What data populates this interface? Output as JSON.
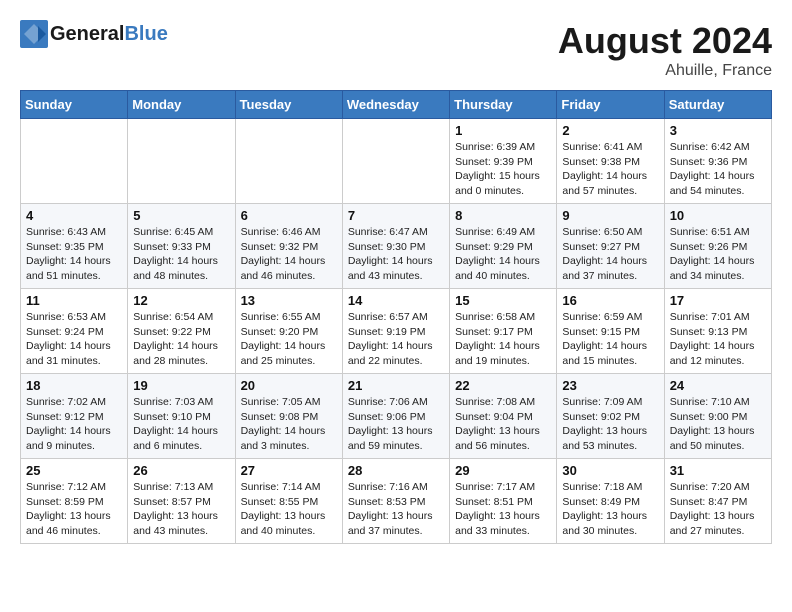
{
  "header": {
    "logo_text_general": "General",
    "logo_text_blue": "Blue",
    "month_year": "August 2024",
    "location": "Ahuille, France"
  },
  "calendar": {
    "days_of_week": [
      "Sunday",
      "Monday",
      "Tuesday",
      "Wednesday",
      "Thursday",
      "Friday",
      "Saturday"
    ],
    "weeks": [
      [
        {
          "day": "",
          "info": ""
        },
        {
          "day": "",
          "info": ""
        },
        {
          "day": "",
          "info": ""
        },
        {
          "day": "",
          "info": ""
        },
        {
          "day": "1",
          "info": "Sunrise: 6:39 AM\nSunset: 9:39 PM\nDaylight: 15 hours\nand 0 minutes."
        },
        {
          "day": "2",
          "info": "Sunrise: 6:41 AM\nSunset: 9:38 PM\nDaylight: 14 hours\nand 57 minutes."
        },
        {
          "day": "3",
          "info": "Sunrise: 6:42 AM\nSunset: 9:36 PM\nDaylight: 14 hours\nand 54 minutes."
        }
      ],
      [
        {
          "day": "4",
          "info": "Sunrise: 6:43 AM\nSunset: 9:35 PM\nDaylight: 14 hours\nand 51 minutes."
        },
        {
          "day": "5",
          "info": "Sunrise: 6:45 AM\nSunset: 9:33 PM\nDaylight: 14 hours\nand 48 minutes."
        },
        {
          "day": "6",
          "info": "Sunrise: 6:46 AM\nSunset: 9:32 PM\nDaylight: 14 hours\nand 46 minutes."
        },
        {
          "day": "7",
          "info": "Sunrise: 6:47 AM\nSunset: 9:30 PM\nDaylight: 14 hours\nand 43 minutes."
        },
        {
          "day": "8",
          "info": "Sunrise: 6:49 AM\nSunset: 9:29 PM\nDaylight: 14 hours\nand 40 minutes."
        },
        {
          "day": "9",
          "info": "Sunrise: 6:50 AM\nSunset: 9:27 PM\nDaylight: 14 hours\nand 37 minutes."
        },
        {
          "day": "10",
          "info": "Sunrise: 6:51 AM\nSunset: 9:26 PM\nDaylight: 14 hours\nand 34 minutes."
        }
      ],
      [
        {
          "day": "11",
          "info": "Sunrise: 6:53 AM\nSunset: 9:24 PM\nDaylight: 14 hours\nand 31 minutes."
        },
        {
          "day": "12",
          "info": "Sunrise: 6:54 AM\nSunset: 9:22 PM\nDaylight: 14 hours\nand 28 minutes."
        },
        {
          "day": "13",
          "info": "Sunrise: 6:55 AM\nSunset: 9:20 PM\nDaylight: 14 hours\nand 25 minutes."
        },
        {
          "day": "14",
          "info": "Sunrise: 6:57 AM\nSunset: 9:19 PM\nDaylight: 14 hours\nand 22 minutes."
        },
        {
          "day": "15",
          "info": "Sunrise: 6:58 AM\nSunset: 9:17 PM\nDaylight: 14 hours\nand 19 minutes."
        },
        {
          "day": "16",
          "info": "Sunrise: 6:59 AM\nSunset: 9:15 PM\nDaylight: 14 hours\nand 15 minutes."
        },
        {
          "day": "17",
          "info": "Sunrise: 7:01 AM\nSunset: 9:13 PM\nDaylight: 14 hours\nand 12 minutes."
        }
      ],
      [
        {
          "day": "18",
          "info": "Sunrise: 7:02 AM\nSunset: 9:12 PM\nDaylight: 14 hours\nand 9 minutes."
        },
        {
          "day": "19",
          "info": "Sunrise: 7:03 AM\nSunset: 9:10 PM\nDaylight: 14 hours\nand 6 minutes."
        },
        {
          "day": "20",
          "info": "Sunrise: 7:05 AM\nSunset: 9:08 PM\nDaylight: 14 hours\nand 3 minutes."
        },
        {
          "day": "21",
          "info": "Sunrise: 7:06 AM\nSunset: 9:06 PM\nDaylight: 13 hours\nand 59 minutes."
        },
        {
          "day": "22",
          "info": "Sunrise: 7:08 AM\nSunset: 9:04 PM\nDaylight: 13 hours\nand 56 minutes."
        },
        {
          "day": "23",
          "info": "Sunrise: 7:09 AM\nSunset: 9:02 PM\nDaylight: 13 hours\nand 53 minutes."
        },
        {
          "day": "24",
          "info": "Sunrise: 7:10 AM\nSunset: 9:00 PM\nDaylight: 13 hours\nand 50 minutes."
        }
      ],
      [
        {
          "day": "25",
          "info": "Sunrise: 7:12 AM\nSunset: 8:59 PM\nDaylight: 13 hours\nand 46 minutes."
        },
        {
          "day": "26",
          "info": "Sunrise: 7:13 AM\nSunset: 8:57 PM\nDaylight: 13 hours\nand 43 minutes."
        },
        {
          "day": "27",
          "info": "Sunrise: 7:14 AM\nSunset: 8:55 PM\nDaylight: 13 hours\nand 40 minutes."
        },
        {
          "day": "28",
          "info": "Sunrise: 7:16 AM\nSunset: 8:53 PM\nDaylight: 13 hours\nand 37 minutes."
        },
        {
          "day": "29",
          "info": "Sunrise: 7:17 AM\nSunset: 8:51 PM\nDaylight: 13 hours\nand 33 minutes."
        },
        {
          "day": "30",
          "info": "Sunrise: 7:18 AM\nSunset: 8:49 PM\nDaylight: 13 hours\nand 30 minutes."
        },
        {
          "day": "31",
          "info": "Sunrise: 7:20 AM\nSunset: 8:47 PM\nDaylight: 13 hours\nand 27 minutes."
        }
      ]
    ]
  }
}
